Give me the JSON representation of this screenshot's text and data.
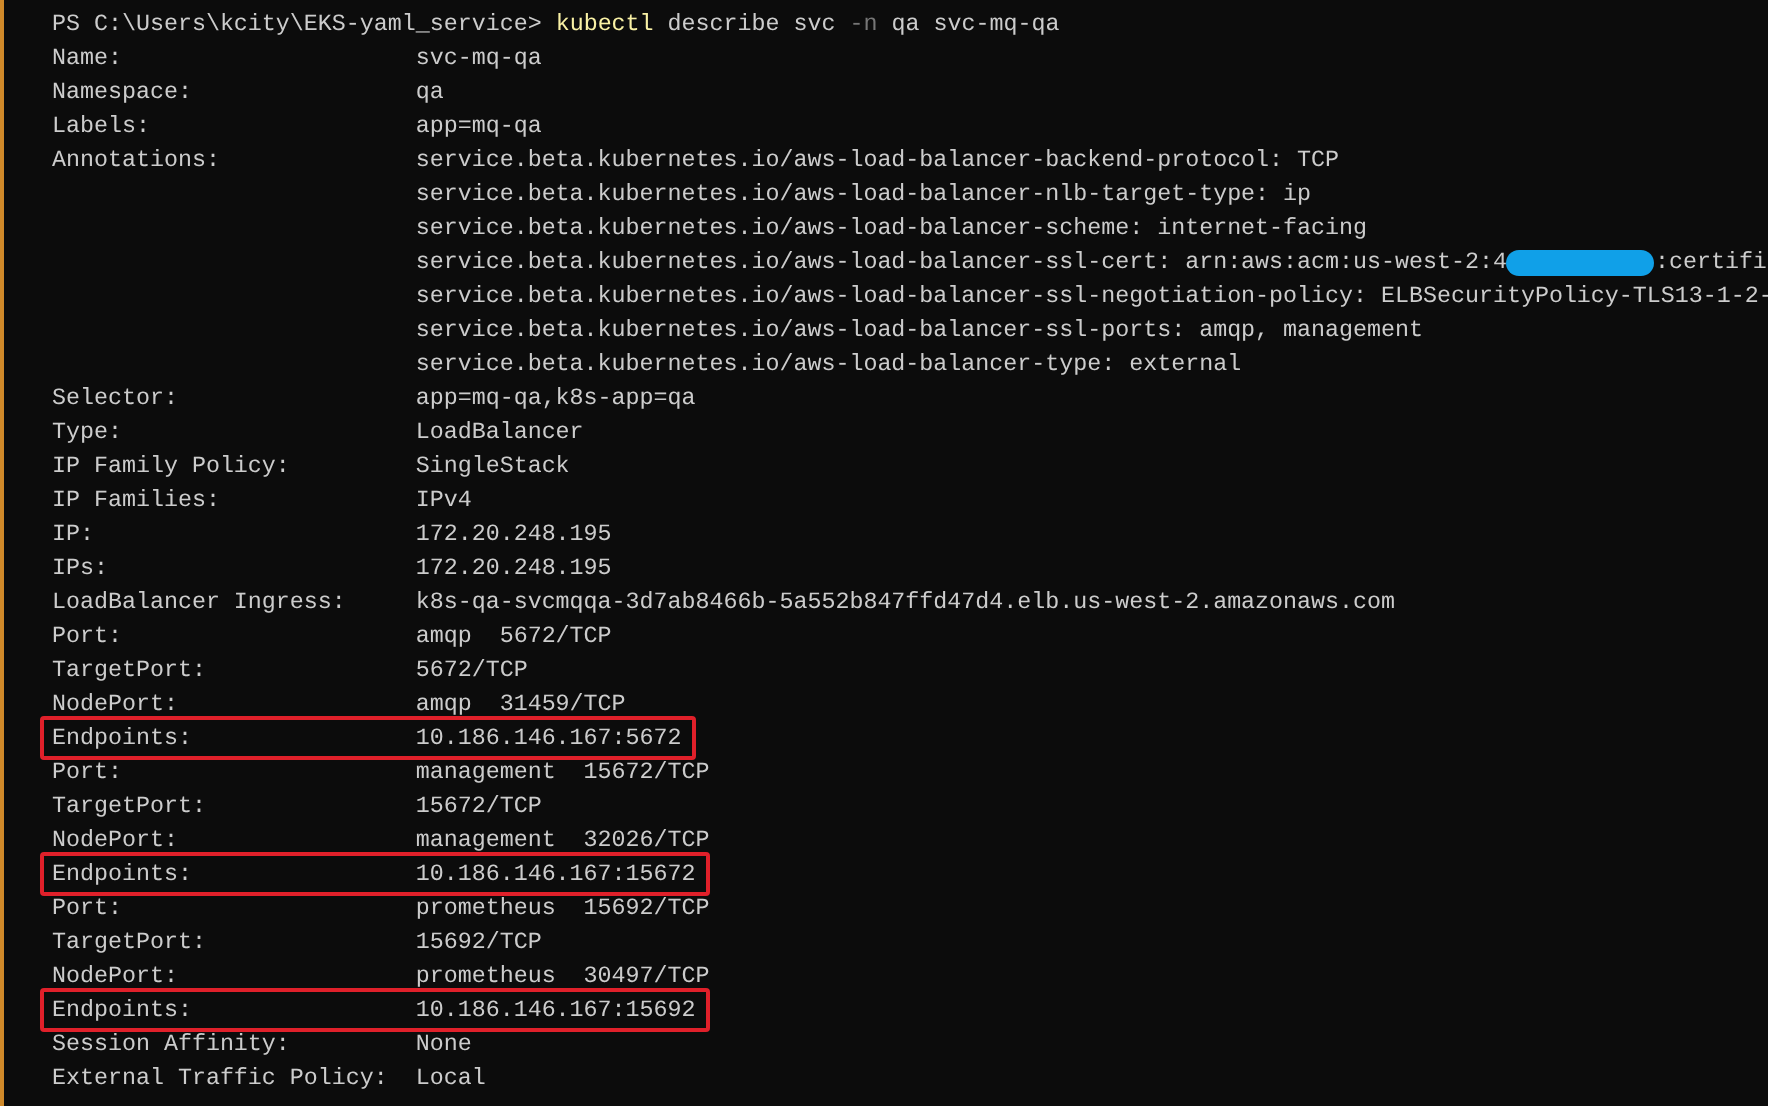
{
  "prompt": {
    "path": "PS C:\\Users\\kcity\\EKS-yaml_service>",
    "command": "kubectl",
    "args": "describe svc",
    "flag": "-n",
    "rest": "qa svc-mq-qa"
  },
  "fields": [
    {
      "label": "Name:",
      "values": [
        {
          "kind": "plain",
          "text": "svc-mq-qa"
        }
      ],
      "highlighted": false
    },
    {
      "label": "Namespace:",
      "values": [
        {
          "kind": "plain",
          "text": "qa"
        }
      ],
      "highlighted": false
    },
    {
      "label": "Labels:",
      "values": [
        {
          "kind": "plain",
          "text": "app=mq-qa"
        }
      ],
      "highlighted": false
    },
    {
      "label": "Annotations:",
      "values": [
        {
          "kind": "plain",
          "text": "service.beta.kubernetes.io/aws-load-balancer-backend-protocol: TCP"
        },
        {
          "kind": "plain",
          "text": "service.beta.kubernetes.io/aws-load-balancer-nlb-target-type: ip"
        },
        {
          "kind": "plain",
          "text": "service.beta.kubernetes.io/aws-load-balancer-scheme: internet-facing"
        },
        {
          "kind": "redacted",
          "text": "service.beta.kubernetes.io/aws-load-balancer-ssl-cert: arn:aws:acm:us-west-2:4",
          "after": ":certifi"
        },
        {
          "kind": "plain",
          "text": "service.beta.kubernetes.io/aws-load-balancer-ssl-negotiation-policy: ELBSecurityPolicy-TLS13-1-2-"
        },
        {
          "kind": "plain",
          "text": "service.beta.kubernetes.io/aws-load-balancer-ssl-ports: amqp, management"
        },
        {
          "kind": "plain",
          "text": "service.beta.kubernetes.io/aws-load-balancer-type: external"
        }
      ],
      "highlighted": false
    },
    {
      "label": "Selector:",
      "values": [
        {
          "kind": "plain",
          "text": "app=mq-qa,k8s-app=qa"
        }
      ],
      "highlighted": false
    },
    {
      "label": "Type:",
      "values": [
        {
          "kind": "plain",
          "text": "LoadBalancer"
        }
      ],
      "highlighted": false
    },
    {
      "label": "IP Family Policy:",
      "values": [
        {
          "kind": "plain",
          "text": "SingleStack"
        }
      ],
      "highlighted": false
    },
    {
      "label": "IP Families:",
      "values": [
        {
          "kind": "plain",
          "text": "IPv4"
        }
      ],
      "highlighted": false
    },
    {
      "label": "IP:",
      "values": [
        {
          "kind": "plain",
          "text": "172.20.248.195"
        }
      ],
      "highlighted": false
    },
    {
      "label": "IPs:",
      "values": [
        {
          "kind": "plain",
          "text": "172.20.248.195"
        }
      ],
      "highlighted": false
    },
    {
      "label": "LoadBalancer Ingress:",
      "values": [
        {
          "kind": "plain",
          "text": "k8s-qa-svcmqqa-3d7ab8466b-5a552b847ffd47d4.elb.us-west-2.amazonaws.com"
        }
      ],
      "highlighted": false
    },
    {
      "label": "Port:",
      "values": [
        {
          "kind": "plain",
          "text": "amqp  5672/TCP"
        }
      ],
      "highlighted": false
    },
    {
      "label": "TargetPort:",
      "values": [
        {
          "kind": "plain",
          "text": "5672/TCP"
        }
      ],
      "highlighted": false
    },
    {
      "label": "NodePort:",
      "values": [
        {
          "kind": "plain",
          "text": "amqp  31459/TCP"
        }
      ],
      "highlighted": false
    },
    {
      "label": "Endpoints:",
      "values": [
        {
          "kind": "plain",
          "text": "10.186.146.167:5672"
        }
      ],
      "highlighted": true
    },
    {
      "label": "Port:",
      "values": [
        {
          "kind": "plain",
          "text": "management  15672/TCP"
        }
      ],
      "highlighted": false
    },
    {
      "label": "TargetPort:",
      "values": [
        {
          "kind": "plain",
          "text": "15672/TCP"
        }
      ],
      "highlighted": false
    },
    {
      "label": "NodePort:",
      "values": [
        {
          "kind": "plain",
          "text": "management  32026/TCP"
        }
      ],
      "highlighted": false
    },
    {
      "label": "Endpoints:",
      "values": [
        {
          "kind": "plain",
          "text": "10.186.146.167:15672"
        }
      ],
      "highlighted": true
    },
    {
      "label": "Port:",
      "values": [
        {
          "kind": "plain",
          "text": "prometheus  15692/TCP"
        }
      ],
      "highlighted": false
    },
    {
      "label": "TargetPort:",
      "values": [
        {
          "kind": "plain",
          "text": "15692/TCP"
        }
      ],
      "highlighted": false
    },
    {
      "label": "NodePort:",
      "values": [
        {
          "kind": "plain",
          "text": "prometheus  30497/TCP"
        }
      ],
      "highlighted": false
    },
    {
      "label": "Endpoints:",
      "values": [
        {
          "kind": "plain",
          "text": "10.186.146.167:15692"
        }
      ],
      "highlighted": true
    },
    {
      "label": "Session Affinity:",
      "values": [
        {
          "kind": "plain",
          "text": "None"
        }
      ],
      "highlighted": false
    },
    {
      "label": "External Traffic Policy:",
      "values": [
        {
          "kind": "plain",
          "text": "Local"
        }
      ],
      "highlighted": false
    }
  ]
}
